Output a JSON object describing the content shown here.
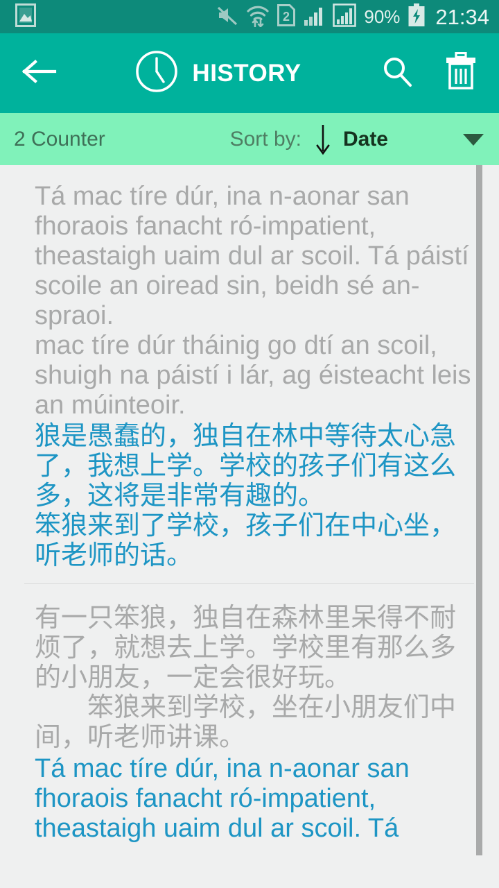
{
  "status_bar": {
    "background_color": "#0d8a7a",
    "left_icons": [
      {
        "name": "gallery-icon",
        "label": "Gallery"
      }
    ],
    "right_icons": [
      {
        "name": "mute-icon",
        "label": "Sound muted"
      },
      {
        "name": "wifi-transfer-icon",
        "label": "Wi-Fi with data transfer"
      },
      {
        "name": "sim-2-icon",
        "label": "2"
      },
      {
        "name": "signal-bars-sim1-icon",
        "label": "Signal bars SIM 1"
      },
      {
        "name": "signal-bars-sim2-icon",
        "label": "Signal bars SIM 2"
      }
    ],
    "battery_percent": "90%",
    "battery_state": "charging",
    "clock": "21:34"
  },
  "app_bar": {
    "background_color": "#00b29c",
    "back_label": "Back",
    "clock_icon": "history-clock-icon",
    "title": "HISTORY",
    "search_label": "Search",
    "delete_label": "Delete all"
  },
  "sort_bar": {
    "background_color": "#80f2ba",
    "counter": "2 Counter",
    "sort_by_label": "Sort by:",
    "sort_direction": "descending",
    "sort_value": "Date",
    "dropdown_icon": "chevron-down-icon"
  },
  "history": {
    "items": [
      {
        "source_text": "Tá mac tíre dúr, ina n-aonar san fhoraois fanacht ró-impatient, theastaigh uaim dul ar scoil. Tá páistí scoile an oiread sin, beidh sé an-spraoi.\nmac tíre dúr tháinig go dtí an scoil, shuigh na páistí i lár, ag éisteacht leis an múinteoir.",
        "translated_text": "狼是愚蠢的，独自在林中等待太心急了，我想上学。学校的孩子们有这么多，这将是非常有趣的。\n笨狼来到了学校，孩子们在中心坐，听老师的话。"
      },
      {
        "source_text": "有一只笨狼，独自在森林里呆得不耐烦了，就想去上学。学校里有那么多的小朋友，一定会很好玩。\n　　笨狼来到学校，坐在小朋友们中间，听老师讲课。",
        "translated_text": "Tá mac tíre dúr, ina n-aonar san fhoraois fanacht ró-impatient, theastaigh uaim dul ar scoil. Tá"
      }
    ]
  },
  "scrollbar": {
    "name": "vertical-scrollbar",
    "color": "#a9aaaa"
  },
  "colors": {
    "source_text": "#a8a9a9",
    "translated_text": "#1d95c4",
    "app_bar": "#00b29c",
    "status_bar": "#0d8a7a",
    "sort_bar": "#80f2ba",
    "list_background": "#eff0f0"
  }
}
